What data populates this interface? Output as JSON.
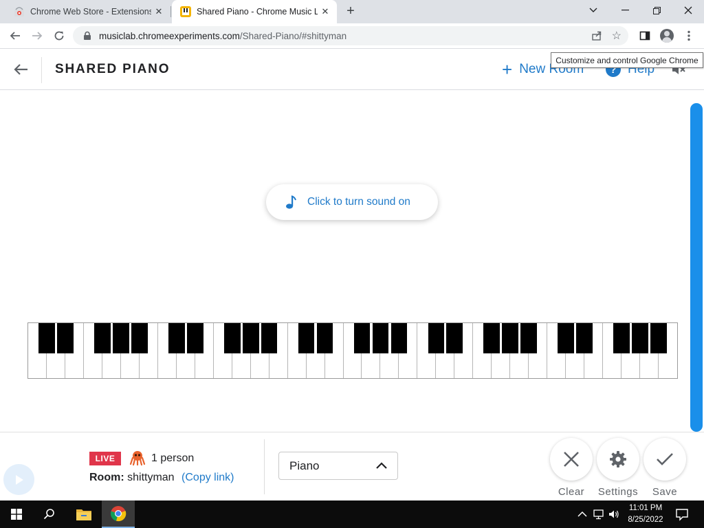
{
  "browser": {
    "tabs": [
      {
        "title": "Chrome Web Store - Extensions",
        "active": false,
        "favicon": "chrome-web-store-icon"
      },
      {
        "title": "Shared Piano - Chrome Music La",
        "active": true,
        "favicon": "chrome-music-lab-icon"
      }
    ],
    "new_tab_label": "+",
    "url_host": "musiclab.chromeexperiments.com",
    "url_path": "/Shared-Piano/#shittyman",
    "tooltip": "Customize and control Google Chrome"
  },
  "header": {
    "title": "SHARED PIANO",
    "new_room_label": "New Room",
    "help_label": "Help",
    "icons": [
      "back-arrow-icon",
      "plus-icon",
      "help-icon",
      "mute-icon"
    ]
  },
  "stage": {
    "sound_prompt": "Click to turn sound on",
    "keyboard": {
      "octaves": 5,
      "white_keys": 35,
      "black_keys": 25
    }
  },
  "bottom_bar": {
    "live_label": "LIVE",
    "people_count": "1 person",
    "room_label": "Room:",
    "room_name": "shittyman",
    "copy_link_label": "(Copy link)",
    "instrument": "Piano",
    "actions": [
      {
        "label": "Clear",
        "icon": "close-icon"
      },
      {
        "label": "Settings",
        "icon": "gear-icon"
      },
      {
        "label": "Save",
        "icon": "check-icon"
      }
    ]
  },
  "taskbar": {
    "time": "11:01 PM",
    "date": "8/25/2022"
  },
  "colors": {
    "accent_blue": "#1f7ac9",
    "live_red": "#e0354a",
    "scrollbar_blue": "#1a8fea",
    "tab_strip": "#dee1e6"
  }
}
